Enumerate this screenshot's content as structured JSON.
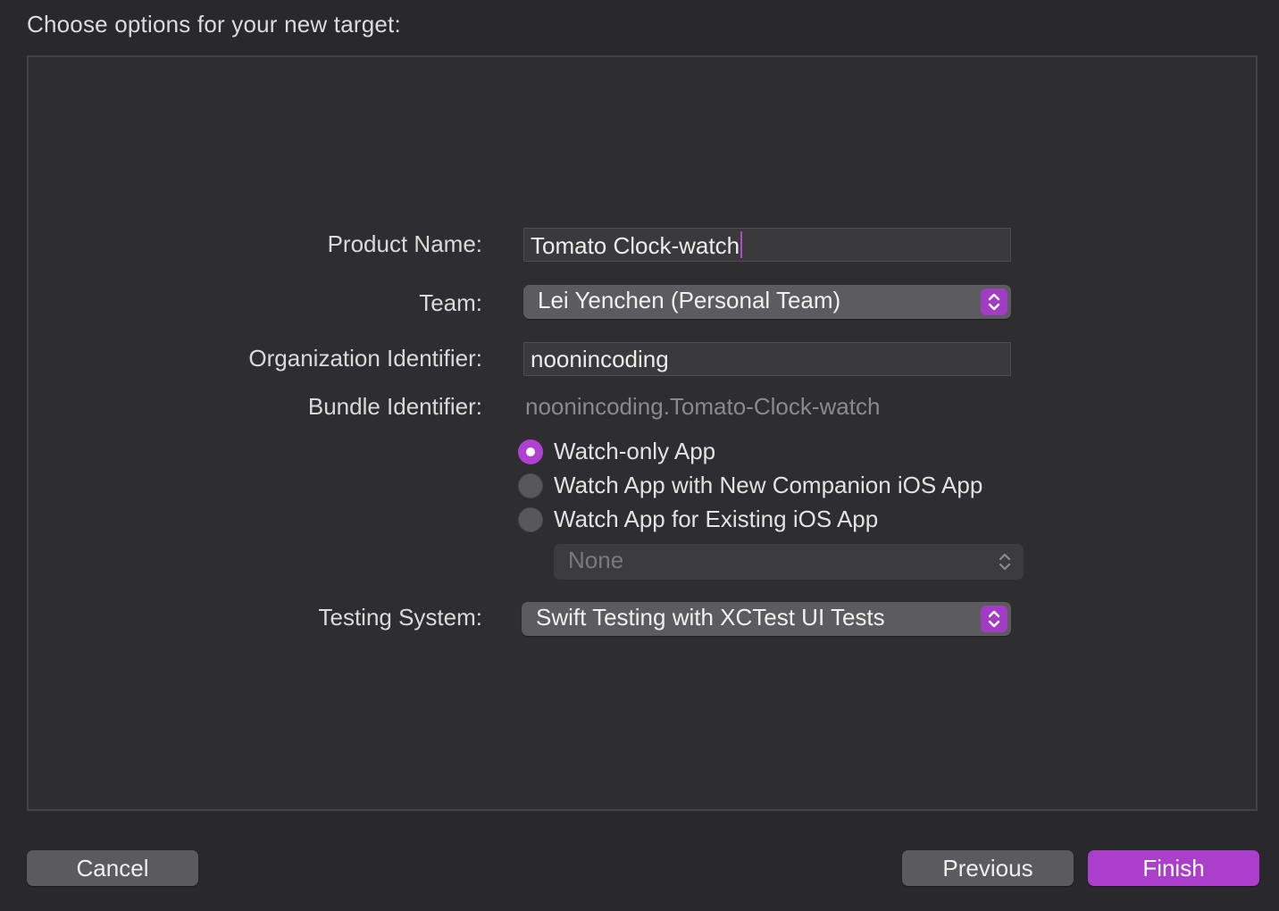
{
  "page": {
    "title": "Choose options for your new target:"
  },
  "form": {
    "product_name": {
      "label": "Product Name:",
      "value": "Tomato Clock-watch"
    },
    "team": {
      "label": "Team:",
      "value": "Lei Yenchen (Personal Team)"
    },
    "organization_identifier": {
      "label": "Organization Identifier:",
      "value": "noonincoding"
    },
    "bundle_identifier": {
      "label": "Bundle Identifier:",
      "value": "noonincoding.Tomato-Clock-watch"
    },
    "watch_app_type": {
      "options": [
        {
          "label": "Watch-only App",
          "selected": true
        },
        {
          "label": "Watch App with New Companion iOS App",
          "selected": false
        },
        {
          "label": "Watch App for Existing iOS App",
          "selected": false
        }
      ],
      "existing_app_popup": {
        "value": "None",
        "enabled": false
      }
    },
    "testing_system": {
      "label": "Testing System:",
      "value": "Swift Testing with XCTest UI Tests"
    }
  },
  "buttons": {
    "cancel": "Cancel",
    "previous": "Previous",
    "finish": "Finish"
  },
  "colors": {
    "accent": "#ab3fcb",
    "background": "#29282d",
    "panel": "#2e2e30"
  }
}
